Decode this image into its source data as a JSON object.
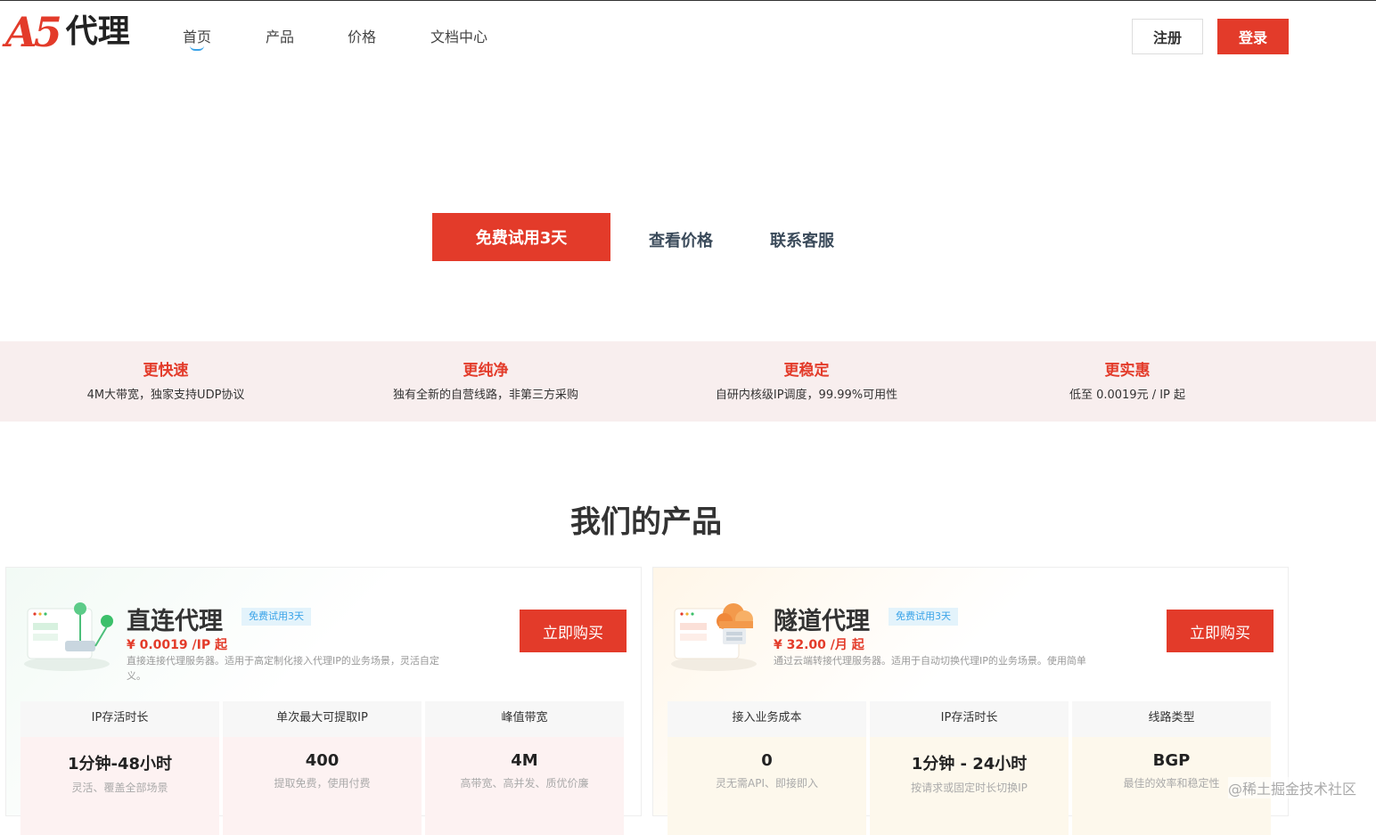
{
  "header": {
    "logo_mark": "A5",
    "logo_text": "代理",
    "nav": [
      {
        "label": "首页",
        "active": true
      },
      {
        "label": "产品",
        "active": false
      },
      {
        "label": "价格",
        "active": false
      },
      {
        "label": "文档中心",
        "active": false
      }
    ],
    "register_label": "注册",
    "login_label": "登录"
  },
  "hero": {
    "trial_label": "免费试用3天",
    "price_link": "查看价格",
    "support_link": "联系客服"
  },
  "features": [
    {
      "title": "更快速",
      "desc": "4M大带宽，独家支持UDP协议"
    },
    {
      "title": "更纯净",
      "desc": "独有全新的自营线路，非第三方采购"
    },
    {
      "title": "更稳定",
      "desc": "自研内核级IP调度，99.99%可用性"
    },
    {
      "title": "更实惠",
      "desc": "低至 0.0019元 / IP 起"
    }
  ],
  "products_title": "我们的产品",
  "products": [
    {
      "name": "直连代理",
      "badge": "免费试用3天",
      "price": "¥ 0.0019 /IP 起",
      "desc": "直接连接代理服务器。适用于高定制化接入代理IP的业务场景，灵活自定义。",
      "buy_label": "立即购买",
      "specs": [
        {
          "label": "IP存活时长",
          "value": "1分钟-48小时",
          "sub": "灵活、覆盖全部场景"
        },
        {
          "label": "单次最大可提取IP",
          "value": "400",
          "sub": "提取免费，使用付费"
        },
        {
          "label": "峰值带宽",
          "value": "4M",
          "sub": "高带宽、高并发、质优价廉"
        }
      ]
    },
    {
      "name": "隧道代理",
      "badge": "免费试用3天",
      "price": "¥ 32.00 /月 起",
      "desc": "通过云端转接代理服务器。适用于自动切换代理IP的业务场景。使用简单",
      "buy_label": "立即购买",
      "specs": [
        {
          "label": "接入业务成本",
          "value": "0",
          "sub": "灵无需API、即接即入"
        },
        {
          "label": "IP存活时长",
          "value": "1分钟 - 24小时",
          "sub": "按请求或固定时长切换IP"
        },
        {
          "label": "线路类型",
          "value": "BGP",
          "sub": "最佳的效率和稳定性"
        }
      ]
    }
  ],
  "watermark": "@稀土掘金技术社区",
  "colors": {
    "brand_red": "#e33b2a",
    "accent_blue": "#3aa3e8",
    "band_bg": "#f8eeee"
  }
}
